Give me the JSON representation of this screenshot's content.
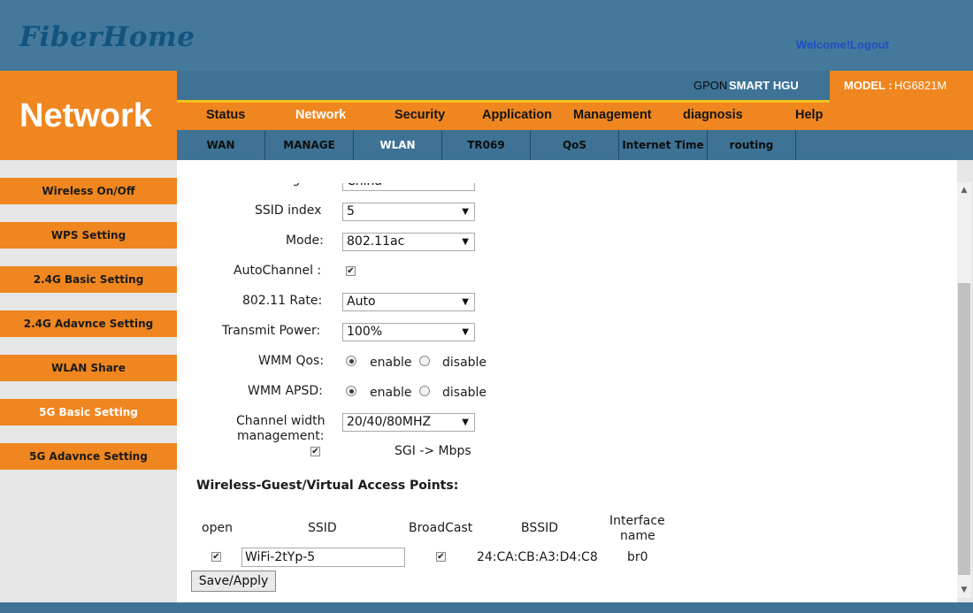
{
  "header": {
    "logo": "FiberHome",
    "welcome": "Welcome!",
    "logout": "Logout",
    "product_prefix": "GPON",
    "product_name": "SMART HGU",
    "model_label": "MODEL :",
    "model_value": "HG6821M"
  },
  "section_title": "Network",
  "main_menu": [
    {
      "label": "Status",
      "active": false
    },
    {
      "label": "Network",
      "active": true
    },
    {
      "label": "Security",
      "active": false
    },
    {
      "label": "Application",
      "active": false
    },
    {
      "label": "Management",
      "active": false
    },
    {
      "label": "diagnosis",
      "active": false
    },
    {
      "label": "Help",
      "active": false
    }
  ],
  "sub_menu": [
    {
      "label": "WAN",
      "active": false
    },
    {
      "label": "MANAGE",
      "active": false
    },
    {
      "label": "WLAN",
      "active": true
    },
    {
      "label": "TR069",
      "active": false
    },
    {
      "label": "QoS",
      "active": false
    },
    {
      "label": "Internet Time",
      "active": false
    },
    {
      "label": "routing",
      "active": false
    }
  ],
  "sidebar": [
    {
      "label": "Wireless On/Off",
      "active": false
    },
    {
      "label": "WPS Setting",
      "active": false
    },
    {
      "label": "2.4G Basic Setting",
      "active": false
    },
    {
      "label": "2.4G Adavnce Setting",
      "active": false
    },
    {
      "label": "WLAN Share",
      "active": false
    },
    {
      "label": "5G Basic Setting",
      "active": true
    },
    {
      "label": "5G Adavnce Setting",
      "active": false
    }
  ],
  "form": {
    "nation_label": "Nation region:",
    "nation_value": "China",
    "ssid_index_label": "SSID index",
    "ssid_index_value": "5",
    "mode_label": "Mode:",
    "mode_value": "802.11ac",
    "autochannel_label": "AutoChannel :",
    "autochannel_checked": true,
    "rate_label": "802.11 Rate:",
    "rate_value": "Auto",
    "power_label": "Transmit Power:",
    "power_value": "100%",
    "wmm_qos_label": "WMM Qos:",
    "wmm_apsd_label": "WMM APSD:",
    "enable_label": "enable",
    "disable_label": "disable",
    "wmm_qos_value": "enable",
    "wmm_apsd_value": "enable",
    "channel_width_label_1": "Channel width",
    "channel_width_label_2": "management:",
    "channel_width_value": "20/40/80MHZ",
    "sgi_label": "SGI -> Mbps",
    "sgi_checked": true
  },
  "guest": {
    "title": "Wireless-Guest/Virtual Access Points:",
    "columns": {
      "open": "open",
      "ssid": "SSID",
      "broadcast": "BroadCast",
      "bssid": "BSSID",
      "interface_1": "Interface",
      "interface_2": "name"
    },
    "row": {
      "open": true,
      "ssid": "WiFi-2tYp-5",
      "broadcast": true,
      "bssid": "24:CA:CB:A3:D4:C8",
      "interface": "br0"
    }
  },
  "save_label": "Save/Apply"
}
